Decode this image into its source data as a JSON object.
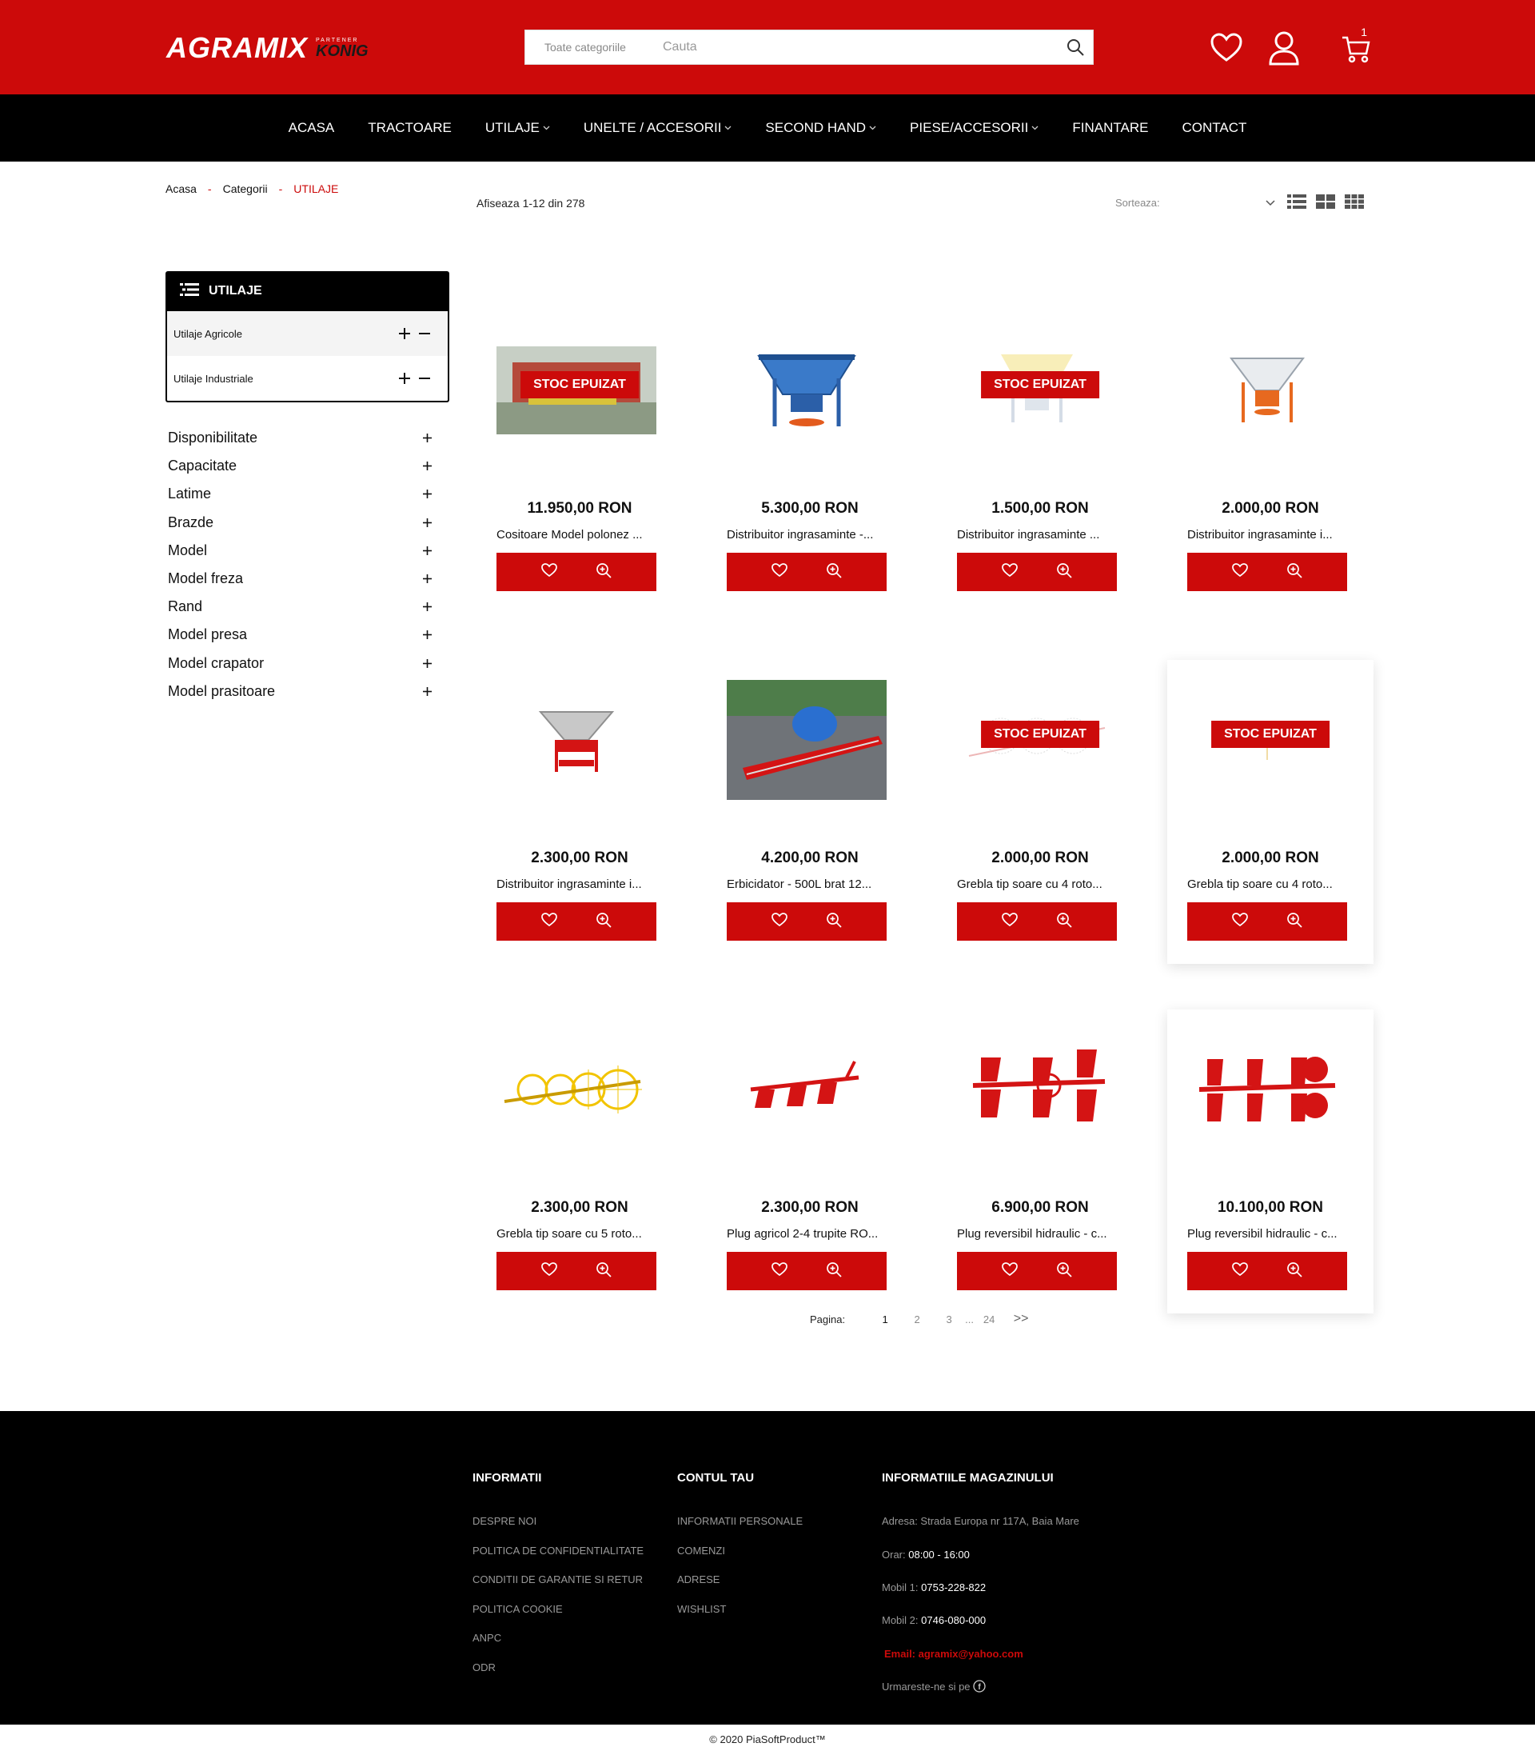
{
  "header": {
    "logo_main": "AGRAMIX",
    "logo_partner_small": "PARTENER",
    "logo_partner_brand": "KONIG",
    "search_category": "Toate categoriile",
    "search_placeholder": "Cauta",
    "cart_count": "1"
  },
  "nav": [
    {
      "label": "ACASA",
      "dropdown": false
    },
    {
      "label": "TRACTOARE",
      "dropdown": false
    },
    {
      "label": "UTILAJE",
      "dropdown": true
    },
    {
      "label": "UNELTE / ACCESORII",
      "dropdown": true
    },
    {
      "label": "SECOND HAND",
      "dropdown": true
    },
    {
      "label": "PIESE/ACCESORII",
      "dropdown": true
    },
    {
      "label": "FINANTARE",
      "dropdown": false
    },
    {
      "label": "CONTACT",
      "dropdown": false
    }
  ],
  "breadcrumb": {
    "home": "Acasa",
    "sep": "-",
    "categories": "Categorii",
    "current": "UTILAJE"
  },
  "toolbar": {
    "results": "Afiseaza 1-12 din 278",
    "sort_label": "Sorteaza:"
  },
  "sidebar": {
    "title": "UTILAJE",
    "categories": [
      "Utilaje Agricole",
      "Utilaje Industriale"
    ],
    "filters": [
      "Disponibilitate",
      "Capacitate",
      "Latime",
      "Brazde",
      "Model",
      "Model freza",
      "Rand",
      "Model presa",
      "Model crapator",
      "Model prasitoare"
    ]
  },
  "products": [
    {
      "price": "11.950,00 RON",
      "name": "Cositoare Model polonez ...",
      "badge": "STOC EPUIZAT",
      "img": "mower-photo"
    },
    {
      "price": "5.300,00 RON",
      "name": "Distribuitor ingrasaminte -...",
      "badge": "",
      "img": "spreader-blue"
    },
    {
      "price": "1.500,00 RON",
      "name": "Distribuitor ingrasaminte ...",
      "badge": "STOC EPUIZAT",
      "img": "spreader-yellow"
    },
    {
      "price": "2.000,00 RON",
      "name": "Distribuitor ingrasaminte i...",
      "badge": "",
      "img": "spreader-orange"
    },
    {
      "price": "2.300,00 RON",
      "name": "Distribuitor ingrasaminte i...",
      "badge": "",
      "img": "spreader-red"
    },
    {
      "price": "4.200,00 RON",
      "name": "Erbicidator - 500L brat 12...",
      "badge": "",
      "img": "sprayer-photo"
    },
    {
      "price": "2.000,00 RON",
      "name": "Grebla tip soare cu 4 roto...",
      "badge": "STOC EPUIZAT",
      "img": "rake-4"
    },
    {
      "price": "2.000,00 RON",
      "name": "Grebla tip soare cu 4 roto...",
      "badge": "STOC EPUIZAT",
      "img": "rake-4b"
    },
    {
      "price": "2.300,00 RON",
      "name": "Grebla tip soare cu 5 roto...",
      "badge": "",
      "img": "rake-5"
    },
    {
      "price": "2.300,00 RON",
      "name": "Plug agricol 2-4 trupite RO...",
      "badge": "",
      "img": "plough-small"
    },
    {
      "price": "6.900,00 RON",
      "name": "Plug reversibil hidraulic - c...",
      "badge": "",
      "img": "plough-rev"
    },
    {
      "price": "10.100,00 RON",
      "name": "Plug reversibil hidraulic - c...",
      "badge": "",
      "img": "plough-rev2"
    }
  ],
  "pagination": {
    "label": "Pagina:",
    "pages": [
      "1",
      "2",
      "3"
    ],
    "dots": "...",
    "last": "24",
    "next": ">>"
  },
  "footer": {
    "info_title": "INFORMATII",
    "info_links": [
      "DESPRE NOI",
      "POLITICA DE CONFIDENTIALITATE",
      "CONDITII DE GARANTIE SI RETUR",
      "POLITICA COOKIE",
      "ANPC",
      "ODR"
    ],
    "account_title": "CONTUL TAU",
    "account_links": [
      "INFORMATII PERSONALE",
      "COMENZI",
      "ADRESE",
      "WISHLIST"
    ],
    "store_title": "INFORMATIILE MAGAZINULUI",
    "address": "Adresa: Strada Europa nr 117A, Baia Mare",
    "hours_label": "Orar:",
    "hours": "08:00 - 16:00",
    "mobile1_label": "Mobil 1:",
    "mobile1": "0753-228-822",
    "mobile2_label": "Mobil 2:",
    "mobile2": "0746-080-000",
    "email": "Email: agramix@yahoo.com",
    "follow": "Urmareste-ne si pe",
    "copyright": "© 2020 PiaSoftProduct™"
  },
  "colors": {
    "accent": "#cc0a0a",
    "dark": "#000000"
  }
}
